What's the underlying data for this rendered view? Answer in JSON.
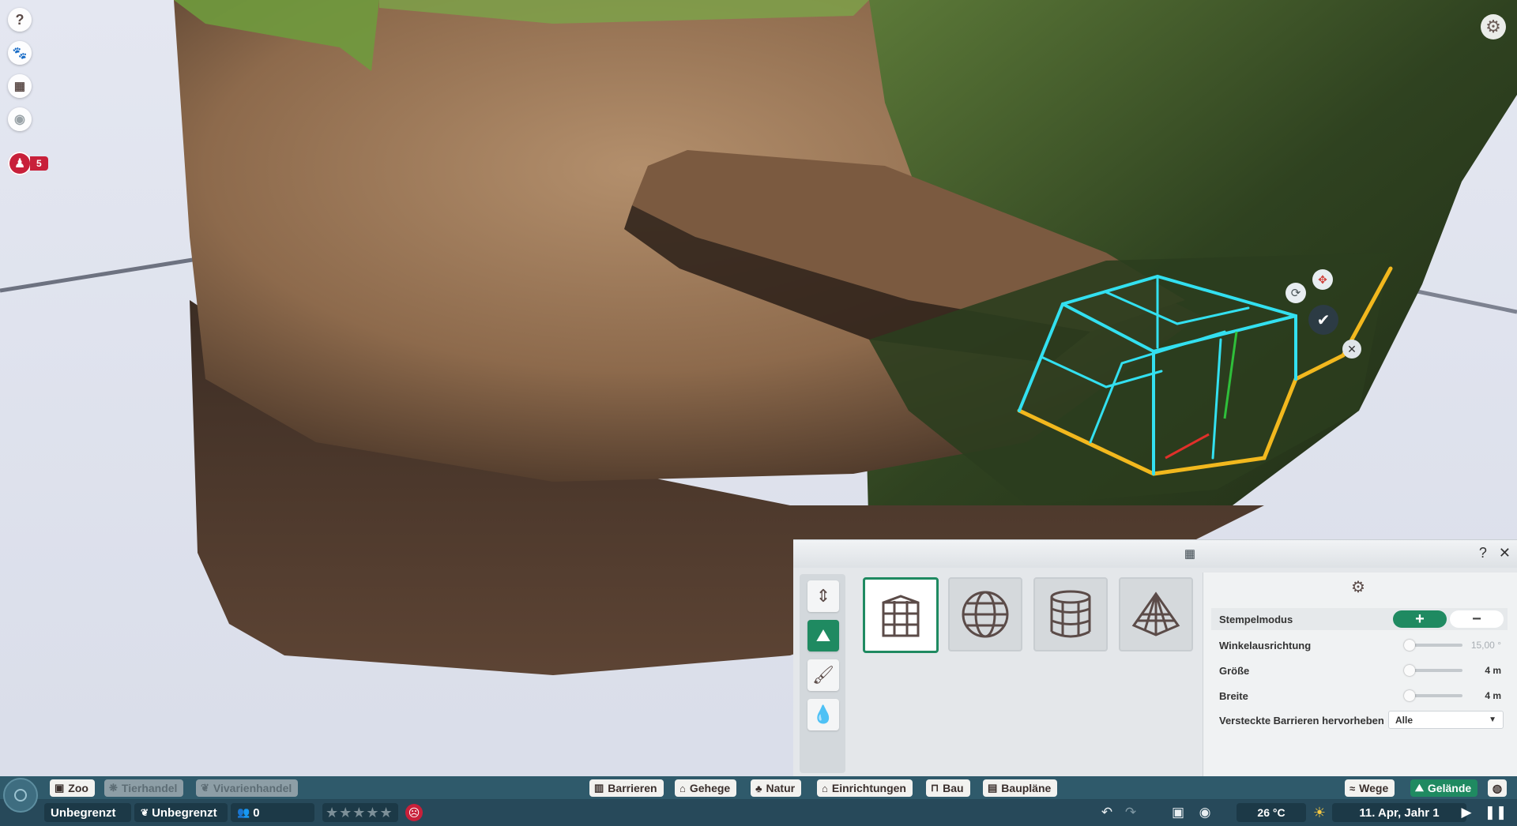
{
  "top_left_icons": [
    "help-icon",
    "animal-icon",
    "calendar-icon",
    "eye-icon"
  ],
  "alert": {
    "icon": "guest-alert-icon",
    "count": "5"
  },
  "settings_icon": "gear-icon",
  "gizmo": {
    "confirm_icon": "check-icon",
    "cancel_icon": "close-icon",
    "rotate_icon": "rotate-icon"
  },
  "panel": {
    "grid_icon": "grid-icon",
    "help": "?",
    "close": "✕",
    "side_tabs": [
      {
        "icon": "terrain-height-icon",
        "active": false
      },
      {
        "icon": "mountain-icon",
        "active": true
      },
      {
        "icon": "paint-brush-icon",
        "active": false
      },
      {
        "icon": "water-drop-icon",
        "active": false
      }
    ],
    "brushes": [
      {
        "icon": "cube-grid-icon",
        "selected": true
      },
      {
        "icon": "sphere-grid-icon",
        "selected": false
      },
      {
        "icon": "cylinder-grid-icon",
        "selected": false
      },
      {
        "icon": "pyramid-grid-icon",
        "selected": false
      }
    ],
    "settings": {
      "stempelmodus": {
        "label": "Stempelmodus",
        "plus": "+",
        "minus": "−",
        "active": "plus"
      },
      "winkel": {
        "label": "Winkelausrichtung",
        "value": "15,00 °",
        "level": 0.05
      },
      "groesse": {
        "label": "Größe",
        "value": "4 m",
        "level": 0.05
      },
      "breite": {
        "label": "Breite",
        "value": "4 m",
        "level": 0.05
      },
      "barrieren": {
        "label": "Versteckte Barrieren hervorheben",
        "selected": "Alle"
      }
    }
  },
  "bottom": {
    "left_tabs": [
      {
        "label": "Zoo",
        "icon": "zoo-icon",
        "dim": false
      },
      {
        "label": "Tierhandel",
        "icon": "paw-icon",
        "dim": true
      },
      {
        "label": "Vivarienhandel",
        "icon": "leaf-icon",
        "dim": true
      }
    ],
    "build_tabs": [
      {
        "label": "Barrieren",
        "icon": "fence-icon"
      },
      {
        "label": "Gehege",
        "icon": "habitat-icon"
      },
      {
        "label": "Natur",
        "icon": "tree-icon"
      },
      {
        "label": "Einrichtungen",
        "icon": "facility-icon"
      },
      {
        "label": "Bau",
        "icon": "construction-icon"
      },
      {
        "label": "Baupläne",
        "icon": "blueprint-icon"
      }
    ],
    "right_tabs": [
      {
        "label": "Wege",
        "icon": "path-icon",
        "green": false
      },
      {
        "label": "Gelände",
        "icon": "terrain-icon",
        "green": true
      }
    ],
    "money": "Unbegrenzt",
    "research": "Unbegrenzt",
    "guests": "0",
    "rating_stars": 0,
    "temperature": "26 °C",
    "weather_icon": "sun-icon",
    "date": "11. Apr, Jahr 1"
  }
}
